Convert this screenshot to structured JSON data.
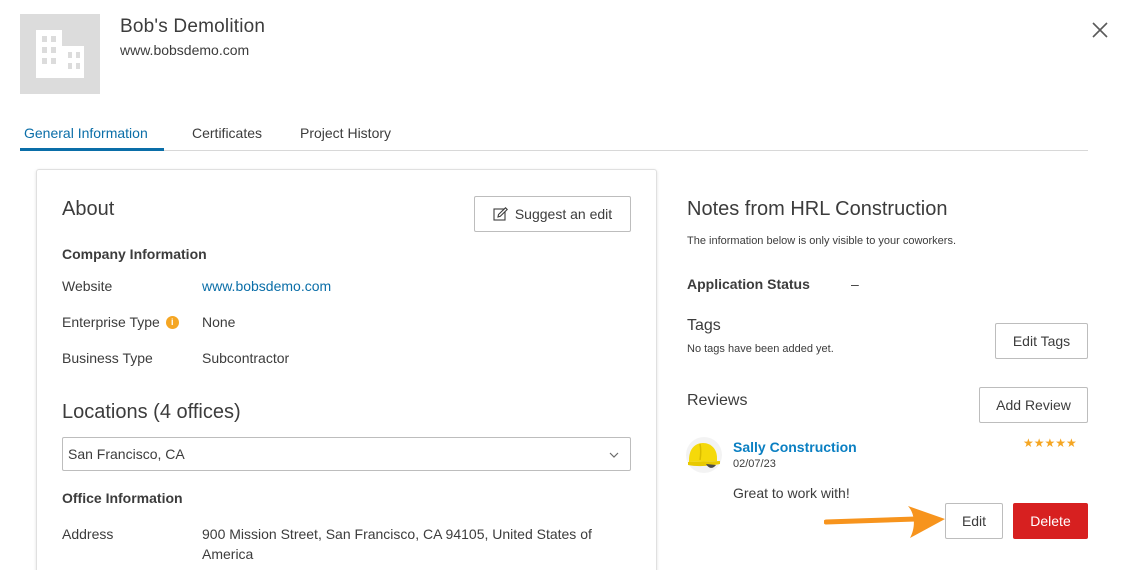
{
  "header": {
    "company_name": "Bob's Demolition",
    "company_url": "www.bobsdemo.com",
    "logo_icon": "building-icon",
    "close_icon": "close-icon"
  },
  "tabs": [
    {
      "label": "General Information",
      "active": true
    },
    {
      "label": "Certificates",
      "active": false
    },
    {
      "label": "Project History",
      "active": false
    }
  ],
  "about": {
    "title": "About",
    "suggest_edit_label": "Suggest an edit",
    "company_info_heading": "Company Information",
    "rows": [
      {
        "label": "Website",
        "value": "www.bobsdemo.com"
      },
      {
        "label": "Enterprise Type",
        "value": "None"
      },
      {
        "label": "Business Type",
        "value": "Subcontractor"
      }
    ],
    "info_icon_glyph": "i",
    "locations_title": "Locations (4 offices)",
    "location_selected": "San Francisco, CA",
    "office_info_heading": "Office Information",
    "address_label": "Address",
    "address_value": "900 Mission Street, San Francisco, CA 94105, United States of America"
  },
  "notes": {
    "title": "Notes from HRL Construction",
    "subtitle": "The information below is only visible to your coworkers.",
    "application_status_label": "Application Status",
    "application_status_value": "–",
    "tags_title": "Tags",
    "tags_empty": "No tags have been added yet.",
    "edit_tags_label": "Edit Tags",
    "reviews_title": "Reviews",
    "add_review_label": "Add Review",
    "review": {
      "reviewer": "Sally Construction",
      "date": "02/07/23",
      "rating": 5,
      "stars": "★★★★★",
      "text": "Great to work with!",
      "edit_label": "Edit",
      "delete_label": "Delete"
    }
  },
  "colors": {
    "accent": "#0a6ea8",
    "link": "#0a7fc2",
    "star": "#f5a623",
    "delete": "#d72020",
    "arrow": "#f7941d"
  }
}
